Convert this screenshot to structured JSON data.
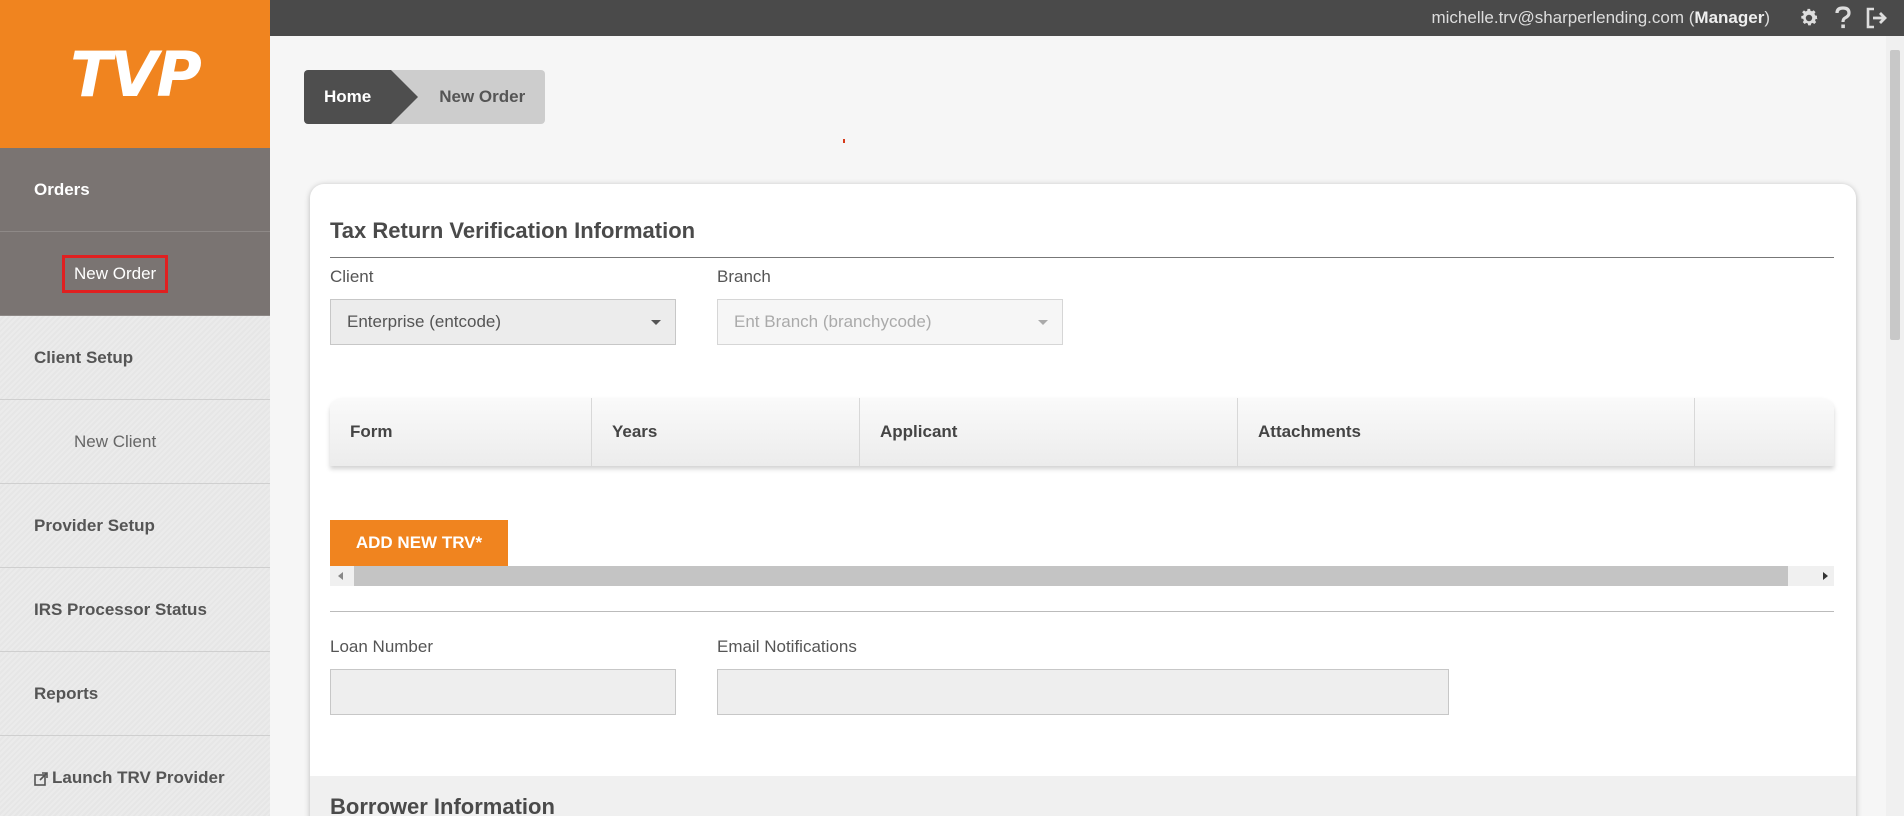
{
  "app": {
    "logo_text": "TVP",
    "user_email": "michelle.trv@sharperlending.com",
    "user_role": "Manager",
    "top_icons": [
      "gear-icon",
      "help-icon",
      "logout-icon"
    ]
  },
  "sidebar": {
    "items": [
      {
        "label": "Orders"
      },
      {
        "label": "New Order"
      },
      {
        "label": "Client Setup"
      },
      {
        "label": "New Client"
      },
      {
        "label": "Provider Setup"
      },
      {
        "label": "IRS Processor Status"
      },
      {
        "label": "Reports"
      },
      {
        "label": "Launch TRV Provider",
        "icon": "external-link-icon"
      }
    ]
  },
  "breadcrumb": {
    "home": "Home",
    "current": "New Order"
  },
  "form": {
    "title": "Tax Return Verification Information",
    "client_label": "Client",
    "client_value": "Enterprise (entcode)",
    "branch_label": "Branch",
    "branch_value": "Ent Branch (branchycode)",
    "table_headers": [
      "Form",
      "Years",
      "Applicant",
      "Attachments",
      ""
    ],
    "add_button": "ADD NEW TRV*",
    "loan_label": "Loan Number",
    "loan_value": "",
    "email_label": "Email Notifications",
    "email_value": "",
    "borrower_title": "Borrower Information"
  },
  "colors": {
    "accent": "#f0841f",
    "sidebar_active": "#7a7472",
    "topbar": "#4a4a4a"
  }
}
